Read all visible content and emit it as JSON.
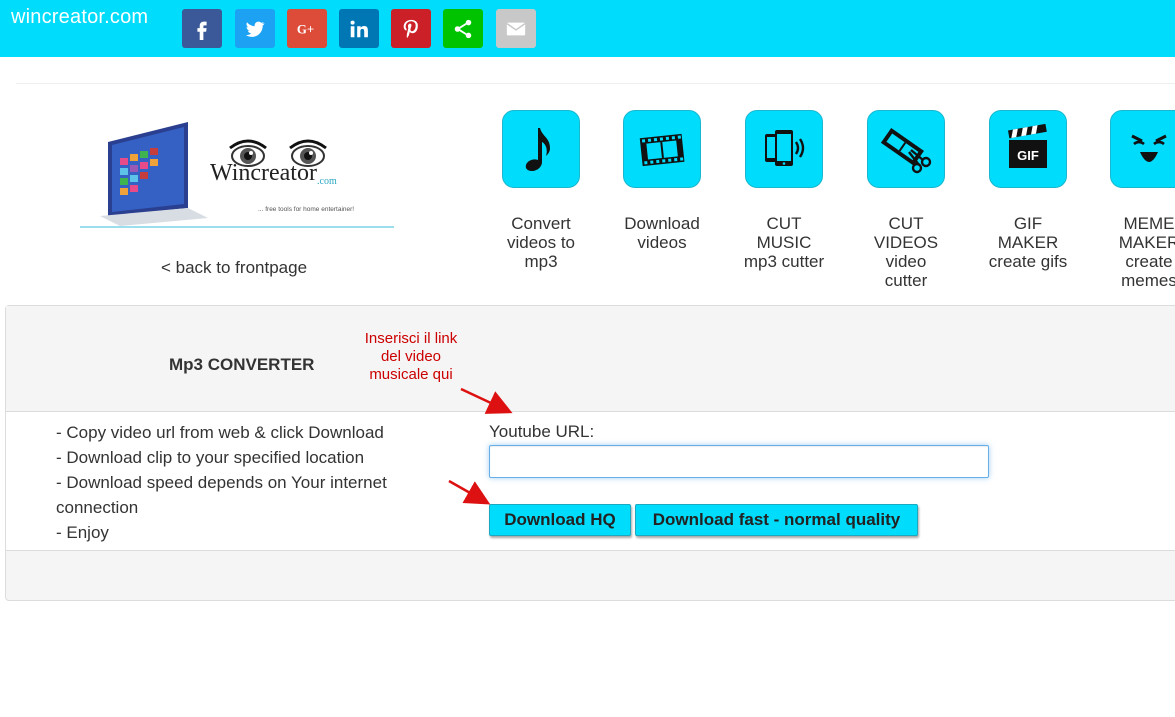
{
  "header": {
    "site_name": "wincreator.com",
    "bar_color": "#00dcfb",
    "share_buttons": [
      {
        "name": "facebook",
        "icon": "facebook-icon",
        "color": "#3b5998"
      },
      {
        "name": "twitter",
        "icon": "twitter-icon",
        "color": "#1da1f2"
      },
      {
        "name": "google-plus",
        "icon": "google-plus-icon",
        "color": "#dd4b39"
      },
      {
        "name": "linkedin",
        "icon": "linkedin-icon",
        "color": "#0077b5"
      },
      {
        "name": "pinterest",
        "icon": "pinterest-icon",
        "color": "#cb2027"
      },
      {
        "name": "share",
        "icon": "share-icon",
        "color": "#00c300"
      },
      {
        "name": "email",
        "icon": "email-icon",
        "color": "#c8c8c8"
      }
    ]
  },
  "logo": {
    "brand": "Wincreator",
    "domain": ".com",
    "tagline": "... free tools for home entertainer!"
  },
  "back_link": "< back to frontpage",
  "tools": [
    {
      "icon": "music-note-icon",
      "lines": [
        "Convert",
        "videos to",
        "mp3"
      ]
    },
    {
      "icon": "film-strip-icon",
      "lines": [
        "Download",
        "videos",
        ""
      ]
    },
    {
      "icon": "phone-audio-icon",
      "lines": [
        "CUT",
        "MUSIC",
        "mp3 cutter"
      ]
    },
    {
      "icon": "film-scissors-icon",
      "lines": [
        "CUT",
        "VIDEOS",
        "video",
        "cutter"
      ]
    },
    {
      "icon": "gif-clapper-icon",
      "lines": [
        "GIF",
        "MAKER",
        "create gifs"
      ],
      "gif_text": "GIF"
    },
    {
      "icon": "meme-face-icon",
      "lines": [
        "MEME",
        "MAKER",
        "create",
        "memes"
      ]
    }
  ],
  "converter": {
    "title": "Mp3 CONVERTER",
    "annotation": [
      "Inserisci il link",
      "del video",
      "musicale qui"
    ],
    "tips": [
      "- Copy video url from web & click Download",
      "- Download clip to your specified location",
      "- Download speed depends on Your internet connection",
      "- Enjoy"
    ],
    "url_label": "Youtube URL:",
    "url_value": "",
    "btn_hq": "Download HQ",
    "btn_fast": "Download fast - normal quality",
    "annotation_color": "#cc0000"
  }
}
